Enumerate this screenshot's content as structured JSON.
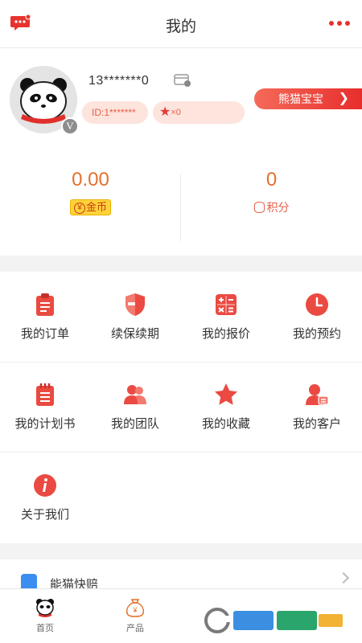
{
  "header": {
    "title": "我的",
    "chat_icon": "chat-bubble-icon",
    "more_icon": "more-dots-icon"
  },
  "profile": {
    "phone": "13*******0",
    "id_text": "ID:1*******",
    "star_count": "×0",
    "v_badge": "V",
    "panda_button": "熊猫宝宝",
    "gold_value": "0.00",
    "gold_label": "金币",
    "gold_symbol": "¥",
    "points_value": "0",
    "points_label": "积分"
  },
  "menu": {
    "items": [
      {
        "label": "我的订单",
        "icon": "clipboard-icon"
      },
      {
        "label": "续保续期",
        "icon": "shield-icon"
      },
      {
        "label": "我的报价",
        "icon": "calculator-icon"
      },
      {
        "label": "我的预约",
        "icon": "clock-icon"
      },
      {
        "label": "我的计划书",
        "icon": "notebook-icon"
      },
      {
        "label": "我的团队",
        "icon": "team-icon"
      },
      {
        "label": "我的收藏",
        "icon": "star-icon"
      },
      {
        "label": "我的客户",
        "icon": "customer-icon"
      },
      {
        "label": "关于我们",
        "icon": "info-icon"
      }
    ]
  },
  "partial_section": {
    "label": "能猫快赔"
  },
  "bottom_nav": {
    "items": [
      {
        "label": "首页",
        "icon": "panda-home-icon"
      },
      {
        "label": "产品",
        "icon": "money-bag-icon"
      }
    ]
  },
  "colors": {
    "accent": "#e8453c",
    "gold": "#e4702b",
    "coin_bg": "#ffd23a"
  }
}
